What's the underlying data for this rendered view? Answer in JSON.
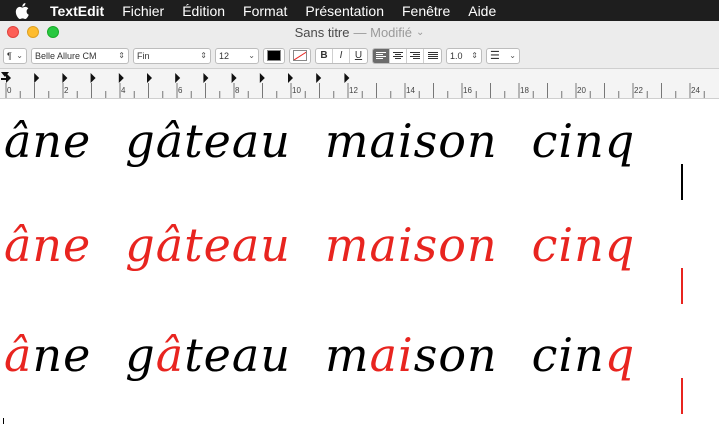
{
  "menubar": {
    "app": "TextEdit",
    "items": [
      "Fichier",
      "Édition",
      "Format",
      "Présentation",
      "Fenêtre",
      "Aide"
    ]
  },
  "window": {
    "title": "Sans titre",
    "status": "— Modifié"
  },
  "toolbar": {
    "paragraph_style": "¶",
    "font_family": "Belle Allure CM",
    "font_style": "Fin",
    "font_size": "12",
    "bold": "B",
    "italic": "I",
    "underline": "U",
    "line_spacing": "1.0"
  },
  "ruler": {
    "numbers": [
      "0",
      "2",
      "4",
      "6",
      "8",
      "10",
      "12",
      "14",
      "16",
      "18",
      "20",
      "22",
      "24"
    ]
  },
  "document": {
    "line1": [
      "âne",
      "gâteau",
      "maison",
      "cinq"
    ],
    "line2": [
      "âne",
      "gâteau",
      "maison",
      "cinq"
    ],
    "line3": [
      [
        {
          "t": "â",
          "c": "red"
        },
        {
          "t": "ne",
          "c": "black"
        }
      ],
      [
        {
          "t": "g",
          "c": "black"
        },
        {
          "t": "â",
          "c": "red"
        },
        {
          "t": "teau",
          "c": "black"
        }
      ],
      [
        {
          "t": "m",
          "c": "black"
        },
        {
          "t": "ai",
          "c": "red"
        },
        {
          "t": "son",
          "c": "black"
        }
      ],
      [
        {
          "t": "cin",
          "c": "black"
        },
        {
          "t": "q",
          "c": "red"
        }
      ]
    ]
  },
  "colors": {
    "accent_red": "#e8241f",
    "menubar_bg": "#1e1e1e",
    "close": "#fd5f57",
    "minimize": "#febc2e",
    "zoom": "#28c840"
  }
}
